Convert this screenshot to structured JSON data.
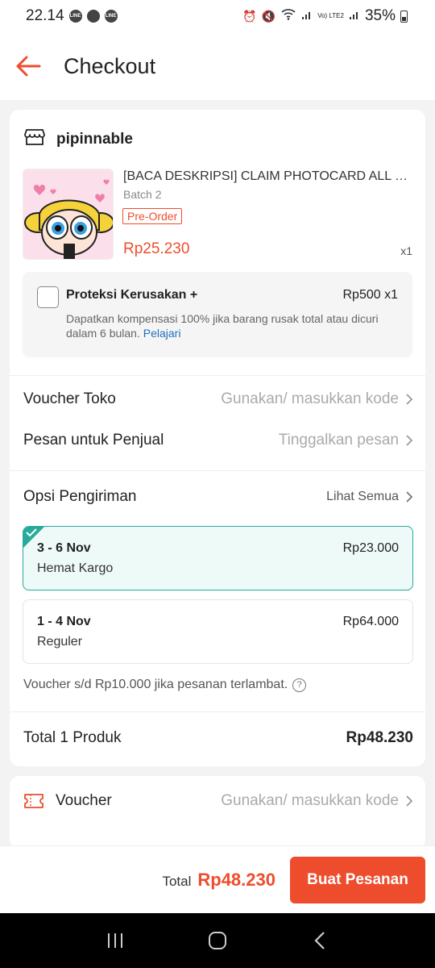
{
  "status_bar": {
    "time": "22.14",
    "apps": [
      "LINE",
      "WA",
      "LINE"
    ],
    "network": "Vo) LTE2",
    "battery": "35%"
  },
  "header": {
    "title": "Checkout"
  },
  "shop": {
    "name": "pipinnable",
    "product": {
      "title": "[BACA DESKRIPSI] CLAIM PHOTOCARD ALL N...",
      "variant": "Batch 2",
      "badge": "Pre-Order",
      "price": "Rp25.230",
      "qty": "x1"
    },
    "protection": {
      "title": "Proteksi Kerusakan +",
      "price": "Rp500 x1",
      "desc": "Dapatkan kompensasi 100% jika barang rusak total atau dicuri dalam 6 bulan.",
      "link": "Pelajari"
    },
    "voucher_toko": {
      "label": "Voucher Toko",
      "hint": "Gunakan/ masukkan kode"
    },
    "message": {
      "label": "Pesan untuk Penjual",
      "hint": "Tinggalkan pesan"
    },
    "shipping": {
      "label": "Opsi Pengiriman",
      "see_all": "Lihat Semua",
      "options": [
        {
          "date": "3 - 6 Nov",
          "name": "Hemat Kargo",
          "price": "Rp23.000",
          "selected": true
        },
        {
          "date": "1 - 4 Nov",
          "name": "Reguler",
          "price": "Rp64.000",
          "selected": false
        }
      ],
      "late_note": "Voucher s/d Rp10.000 jika pesanan terlambat."
    },
    "total": {
      "label": "Total 1 Produk",
      "value": "Rp48.230"
    }
  },
  "voucher": {
    "label": "Voucher",
    "hint": "Gunakan/ masukkan kode"
  },
  "bottom_bar": {
    "total_label": "Total",
    "total_value": "Rp48.230",
    "order_button": "Buat Pesanan"
  },
  "colors": {
    "accent": "#ee4d2d",
    "selected": "#26aa99"
  }
}
